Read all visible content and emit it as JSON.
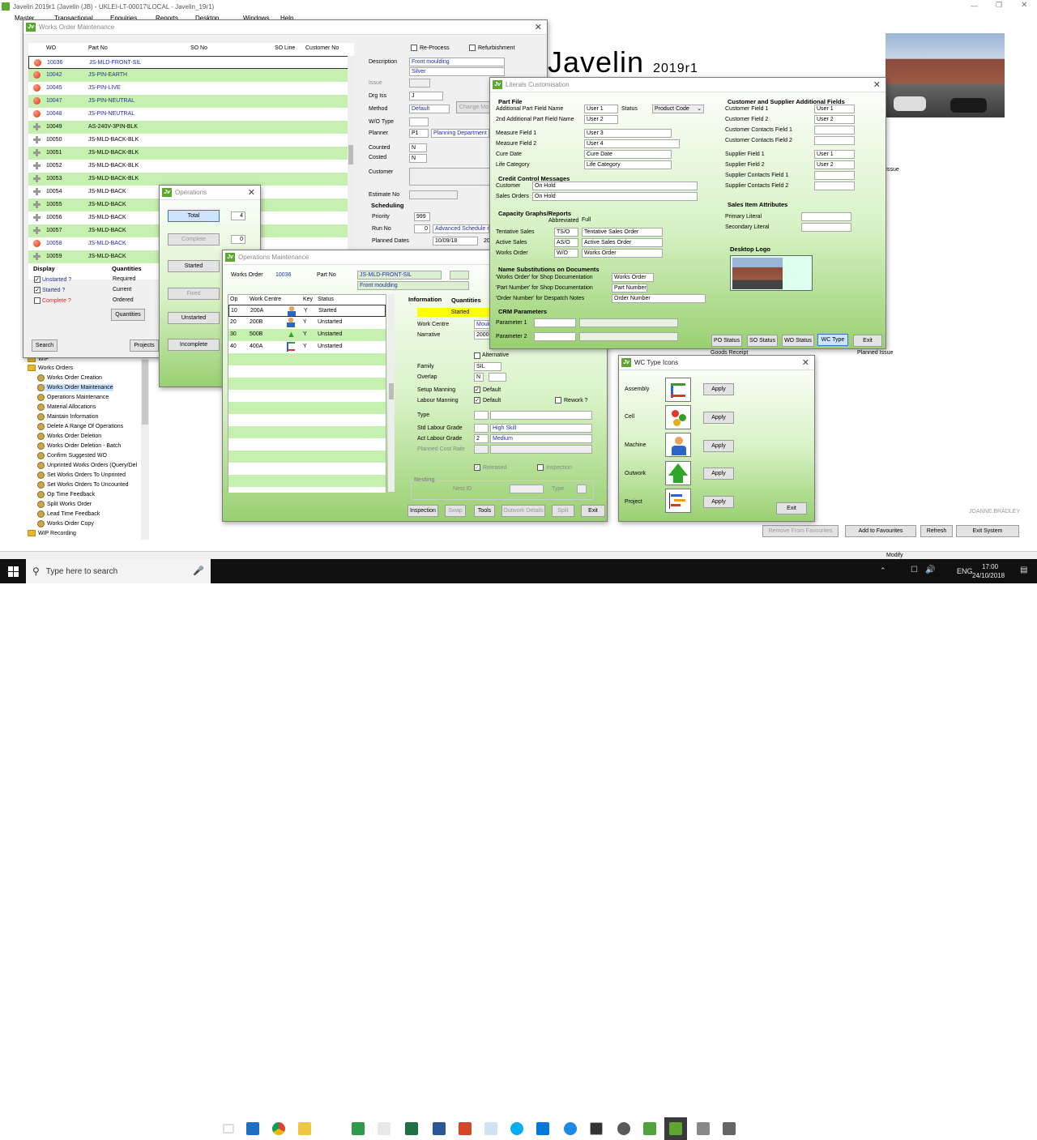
{
  "app": {
    "title": "Javelin 2019r1 (Javelin (JB) - UKLEI-LT-00017\\LOCAL - Javelin_19r1)",
    "menu": [
      "Master",
      "Transactional",
      "Enquiries",
      "Reports",
      "Desktop",
      "Windows",
      "Help"
    ],
    "brand": "Javelin",
    "version": "2019r1",
    "user": "JOANNE.BRADLEY",
    "mode": "Modify",
    "bottom_buttons": [
      "Remove From Favourites",
      "Add to Favourites",
      "Refresh",
      "Exit System"
    ],
    "bg_labels": {
      "goods_receipt": "Goods Receipt",
      "planned_issue": "Planned Issue",
      "issue": "Issue"
    }
  },
  "tree": {
    "items": [
      {
        "label": "WIP",
        "type": "folder"
      },
      {
        "label": "Works Orders",
        "type": "folder"
      },
      {
        "label": "Works Order Creation",
        "type": "gear"
      },
      {
        "label": "Works Order Maintenance",
        "type": "gear"
      },
      {
        "label": "Operations Maintenance",
        "type": "gear"
      },
      {
        "label": "Material Allocations",
        "type": "gear"
      },
      {
        "label": "Maintain Information",
        "type": "gear"
      },
      {
        "label": "Delete A Range Of Operations",
        "type": "gear"
      },
      {
        "label": "Works Order Deletion",
        "type": "gear"
      },
      {
        "label": "Works Order Deletion - Batch",
        "type": "gear"
      },
      {
        "label": "Confirm Suggested WO",
        "type": "gear"
      },
      {
        "label": "Unprinted Works Orders (Query/Del",
        "type": "gear"
      },
      {
        "label": "Set Works Orders To Unprinted",
        "type": "gear"
      },
      {
        "label": "Set Works Orders To Uncounted",
        "type": "gear"
      },
      {
        "label": "Op Time Feedback",
        "type": "gear"
      },
      {
        "label": "Split Works Order",
        "type": "gear"
      },
      {
        "label": "Lead Time Feedback",
        "type": "gear"
      },
      {
        "label": "Works Order Copy",
        "type": "gear"
      },
      {
        "label": "WIP Recording",
        "type": "folder"
      }
    ]
  },
  "wom": {
    "title": "Works Order Maintenance",
    "headers": [
      "WO",
      "Part No",
      "SO No",
      "SO Line",
      "Customer No"
    ],
    "rows": [
      {
        "wo": "10036",
        "part": "JS-MLD-FRONT-SIL",
        "status": "red"
      },
      {
        "wo": "10042",
        "part": "JS-PIN-EARTH",
        "status": "red"
      },
      {
        "wo": "10045",
        "part": "JS-PIN-LIVE",
        "status": "red"
      },
      {
        "wo": "10047",
        "part": "JS-PIN-NEUTRAL",
        "status": "red"
      },
      {
        "wo": "10048",
        "part": "JS-PIN-NEUTRAL",
        "status": "red"
      },
      {
        "wo": "10049",
        "part": "AS-240V-3PIN-BLK",
        "status": "plus"
      },
      {
        "wo": "10050",
        "part": "JS-MLD-BACK-BLK",
        "status": "plus"
      },
      {
        "wo": "10051",
        "part": "JS-MLD-BACK-BLK",
        "status": "plus"
      },
      {
        "wo": "10052",
        "part": "JS-MLD-BACK-BLK",
        "status": "plus"
      },
      {
        "wo": "10053",
        "part": "JS-MLD-BACK-BLK",
        "status": "plus"
      },
      {
        "wo": "10054",
        "part": "JS-MLD-BACK",
        "status": "plus"
      },
      {
        "wo": "10055",
        "part": "JS-MLD-BACK",
        "status": "plus"
      },
      {
        "wo": "10056",
        "part": "JS-MLD-BACK",
        "status": "plus"
      },
      {
        "wo": "10057",
        "part": "JS-MLD-BACK",
        "status": "plus"
      },
      {
        "wo": "10058",
        "part": "JS-MLD-BACK",
        "status": "red"
      },
      {
        "wo": "10059",
        "part": "JS-MLD-BACK",
        "status": "plus"
      }
    ],
    "reprocess": "Re-Process",
    "refurbishment": "Refurbishment",
    "fields": {
      "description_label": "Description",
      "description": "Front moulding",
      "description2": "Silver",
      "issue_label": "Issue",
      "drg_iss_label": "Drg Iss",
      "drg_iss": "J",
      "method_label": "Method",
      "method": "Default",
      "change_method": "Change Mo",
      "wo_type_label": "W/O Type",
      "planner_label": "Planner",
      "planner_code": "P1",
      "planner_name": "Planning Department",
      "counted_label": "Counted",
      "counted": "N",
      "costed_label": "Costed",
      "costed": "N",
      "customer_label": "Customer",
      "estimate_label": "Estimate No",
      "scheduling_label": "Scheduling",
      "priority_label": "Priority",
      "priority": "999",
      "run_no_label": "Run No",
      "run_no": "0",
      "adv_sched": "Advanced Schedule r",
      "planned_dates_label": "Planned Dates",
      "planned_date": "10/09/18",
      "planned_date2": "20"
    },
    "display_label": "Display",
    "display_items": [
      {
        "label": "Unstarted ?",
        "checked": true,
        "color": "#1c2fa6"
      },
      {
        "label": "Started ?",
        "checked": true,
        "color": "#1c2fa6"
      },
      {
        "label": "Complete ?",
        "checked": false,
        "color": "#e02020"
      }
    ],
    "quantities_label": "Quantities",
    "quantities_items": [
      "Required",
      "Current",
      "Ordered"
    ],
    "quantities_btn": "Quantities",
    "search_btn": "Search",
    "projects_btn": "Projects"
  },
  "ops_small": {
    "title": "Operations",
    "total_btn": "Total",
    "total_val": "4",
    "complete_btn": "Complete",
    "complete_val": "0",
    "started_btn": "Started",
    "fixed_btn": "Fixed",
    "unstarted_btn": "Unstarted",
    "incomplete_btn": "Incomplete"
  },
  "opm": {
    "title": "Operations Maintenance",
    "works_order_label": "Works Order",
    "works_order": "10036",
    "part_no_label": "Part No",
    "part_no": "JS-MLD-FRONT-SIL",
    "part_desc": "Front moulding",
    "headers": [
      "Op",
      "Work Centre",
      "Key",
      "Status"
    ],
    "rows": [
      {
        "op": "10",
        "wc": "200A",
        "key": "Y",
        "status": "Started",
        "icon": "person"
      },
      {
        "op": "20",
        "wc": "200B",
        "key": "Y",
        "status": "Unstarted",
        "icon": "person"
      },
      {
        "op": "30",
        "wc": "500B",
        "key": "Y",
        "status": "Unstarted",
        "icon": "arrow"
      },
      {
        "op": "40",
        "wc": "400A",
        "key": "Y",
        "status": "Unstarted",
        "icon": "assembly"
      }
    ],
    "tabs": [
      "Information",
      "Quantities"
    ],
    "status_banner": "Started",
    "work_centre_label": "Work Centre",
    "work_centre": "Mould",
    "narrative_label": "Narrative",
    "narrative": "20000",
    "alternative_label": "Alternative",
    "family_label": "Family",
    "family": "SIL",
    "overlap_label": "Overlap",
    "overlap": "N",
    "setup_manning_label": "Setup Manning",
    "labour_manning_label": "Labour Manning",
    "default_label": "Default",
    "rework_label": "Rework ?",
    "type_label": "Type",
    "std_labour_label": "Std Labour Grade",
    "std_labour": "High Skill",
    "act_labour_label": "Act Labour Grade",
    "act_labour_code": "2",
    "act_labour": "Medium",
    "planned_cost_label": "Planned Cost Rate",
    "released_label": "Released",
    "inspection_label": "Inspection",
    "nesting_label": "Nesting",
    "nest_id_label": "Nest ID",
    "buttons": [
      "Inspection",
      "Swap",
      "Tools",
      "Outwork Details",
      "Split",
      "Exit"
    ]
  },
  "lit": {
    "title": "Literals Customisation",
    "part_file": "Part File",
    "add_part_field1_label": "Additional Part Field Name",
    "add_part_field1": "User 1",
    "status_label": "Status",
    "status_value": "Product Code",
    "add_part_field2_label": "2nd Additional Part Field Name",
    "add_part_field2": "User 2",
    "measure1_label": "Measure Field 1",
    "measure1": "User 3",
    "measure2_label": "Measure Field 2",
    "measure2": "User 4",
    "cure_label": "Cure Date",
    "cure": "Cure Date",
    "life_label": "Life Category",
    "life": "Life Category",
    "credit_label": "Credit Control Messages",
    "cc_customer_label": "Customer",
    "cc_customer": "On Hold",
    "cc_sales_label": "Sales Orders",
    "cc_sales": "On Hold",
    "capacity_label": "Capacity Graphs/Reports",
    "abbrev_label": "Abbreviated",
    "full_label": "Full",
    "cap_rows": [
      {
        "label": "Tentative Sales",
        "abbr": "TS/O",
        "full": "Tentative Sales Order"
      },
      {
        "label": "Active Sales",
        "abbr": "AS/O",
        "full": "Active Sales Order"
      },
      {
        "label": "Works Order",
        "abbr": "W/O",
        "full": "Works Order"
      }
    ],
    "name_subs_label": "Name Substitutions on Documents",
    "subs_rows": [
      {
        "label": "'Works Order' for Shop Documentation",
        "value": "Works Order"
      },
      {
        "label": "'Part Number' for Shop Documentation",
        "value": "Part Number"
      },
      {
        "label": "'Order Number' for Despatch Notes",
        "value": "Order Number"
      }
    ],
    "crm_label": "CRM Parameters",
    "crm_rows": [
      "Parameter 1",
      "Parameter 2"
    ],
    "cust_supp_label": "Customer and Supplier Additional Fields",
    "cs_rows": [
      {
        "label": "Customer Field 1",
        "value": "User 1"
      },
      {
        "label": "Customer Field 2",
        "value": "User 2"
      },
      {
        "label": "Customer Contacts Field 1",
        "value": ""
      },
      {
        "label": "Customer Contacts Field 2",
        "value": ""
      },
      {
        "label": "Supplier Field 1",
        "value": "User 1"
      },
      {
        "label": "Supplier Field 2",
        "value": "User 2"
      },
      {
        "label": "Supplier Contacts Field 1",
        "value": ""
      },
      {
        "label": "Supplier Contacts Field 2",
        "value": ""
      }
    ],
    "sales_attr_label": "Sales Item Attributes",
    "primary_label": "Primary Literal",
    "secondary_label": "Secondary Literal",
    "desktop_logo_label": "Desktop Logo",
    "buttons": [
      "PO Status",
      "SO Status",
      "WO Status",
      "WC Type",
      "Exit"
    ]
  },
  "wc": {
    "title": "WC Type Icons",
    "rows": [
      "Assembly",
      "Cell",
      "Machine",
      "Outwork",
      "Project"
    ],
    "apply": "Apply",
    "exit": "Exit"
  },
  "taskbar": {
    "search_placeholder": "Type here to search",
    "lang": "ENG",
    "time": "17:00",
    "date": "24/10/2018"
  },
  "colors": {
    "green_row": "#c6f0b0",
    "accent_green": "#5ea631",
    "blue_text": "#1c2fa6",
    "taskbar": "#101010"
  }
}
